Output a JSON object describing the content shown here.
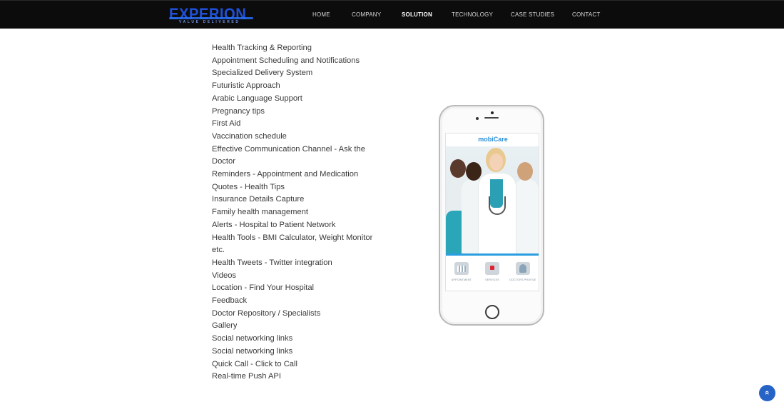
{
  "brand": {
    "logo_text": "EXPERION",
    "tagline": "VALUE DELIVERED"
  },
  "nav": {
    "items": [
      {
        "label": "HOME"
      },
      {
        "label": "COMPANY"
      },
      {
        "label": "SOLUTION",
        "active": true
      },
      {
        "label": "TECHNOLOGY"
      },
      {
        "label": "CASE STUDIES"
      },
      {
        "label": "CONTACT"
      }
    ]
  },
  "features": [
    "Health Tracking & Reporting",
    "Appointment Scheduling and Notifications",
    "Specialized Delivery System",
    "Futuristic Approach",
    "Arabic Language Support",
    "Pregnancy tips",
    "First Aid",
    "Vaccination schedule",
    "Effective Communication Channel - Ask the",
    "Doctor",
    "Reminders - Appointment and Medication",
    "Quotes - Health Tips",
    "Insurance Details Capture",
    "Family health management",
    "Alerts - Hospital to Patient Network",
    "Health Tools - BMI Calculator, Weight Monitor",
    "etc.",
    "Health Tweets - Twitter integration",
    "Videos",
    "Location - Find Your Hospital",
    "Feedback",
    "Doctor Repository / Specialists",
    "Gallery",
    "Social networking links",
    "Social networking links",
    "Quick Call - Click to Call",
    "Real-time Push API"
  ],
  "phone": {
    "app_name": "mobiCare",
    "icons": [
      {
        "label": "APPOINTMENT",
        "icon": "calendar-icon"
      },
      {
        "label": "SERVICES",
        "icon": "medical-kit-icon"
      },
      {
        "label": "DOCTORS PROFILE",
        "icon": "doctor-icon"
      }
    ]
  },
  "scroll_top": {
    "icon": "double-chevron-up-icon",
    "glyph": "«"
  },
  "colors": {
    "header_bg": "#0c0c0c",
    "logo_blue": "#1f4fd6",
    "text": "#3a3a3a",
    "accent": "#2563c7",
    "app_title": "#2a8fd9"
  }
}
